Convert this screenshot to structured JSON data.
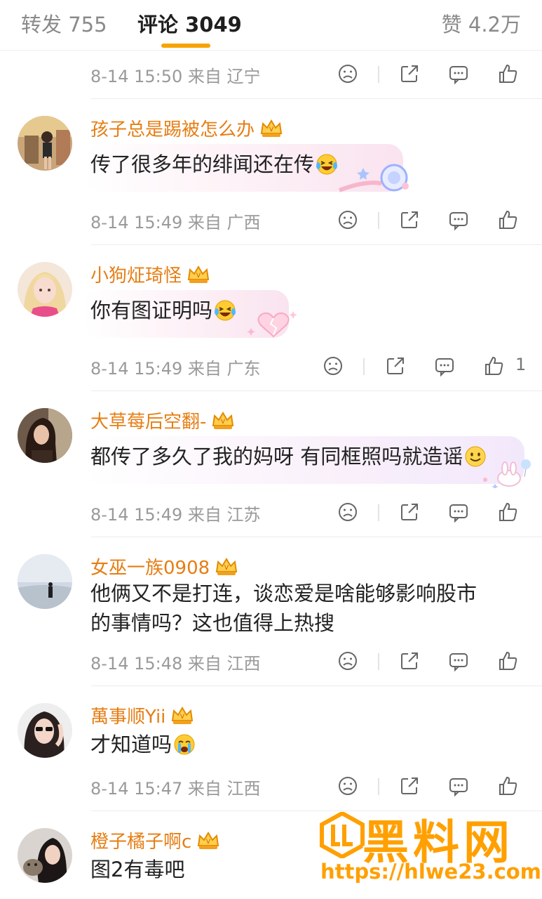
{
  "tabs": {
    "repost": "转发 755",
    "comment": "评论 3049",
    "like": "赞 4.2万",
    "accent": "#f7a300"
  },
  "top_meta": {
    "time": "8-14 15:50 来自 辽宁"
  },
  "comments": [
    {
      "username": "孩子总是踢被怎么办",
      "text": "传了很多年的绯闻还在传",
      "emoji": "laughing-tears-emoji",
      "time": "8-14 15:49 来自 广西",
      "likes": ""
    },
    {
      "username": "小狗炡琦怪",
      "text": "你有图证明吗",
      "emoji": "laughing-tears-emoji",
      "time": "8-14 15:49 来自 广东",
      "likes": "1"
    },
    {
      "username": "大草莓后空翻-",
      "text": "都传了多久了我的妈呀 有同框照吗就造谣",
      "emoji": "smile-emoji",
      "time": "8-14 15:49 来自 江苏",
      "likes": ""
    },
    {
      "username": "女巫一族0908",
      "text_line1": "他俩又不是打连，谈恋爱是啥能够影响股市",
      "text_line2": "的事情吗？这也值得上热搜",
      "time": "8-14 15:48 来自 江西",
      "likes": ""
    },
    {
      "username": "萬事顺Yii",
      "text": "才知道吗",
      "emoji": "crying-emoji",
      "time": "8-14 15:47 来自 江西",
      "likes": ""
    },
    {
      "username": "橙子橘子啊c",
      "text": "图2有毒吧"
    }
  ],
  "colors": {
    "username": "#e67e14",
    "meta": "#9a9a9a",
    "text": "#222222",
    "watermark": "#ffa000"
  },
  "watermark": {
    "title": "黑料网",
    "url": "https://hlwe23.com"
  }
}
